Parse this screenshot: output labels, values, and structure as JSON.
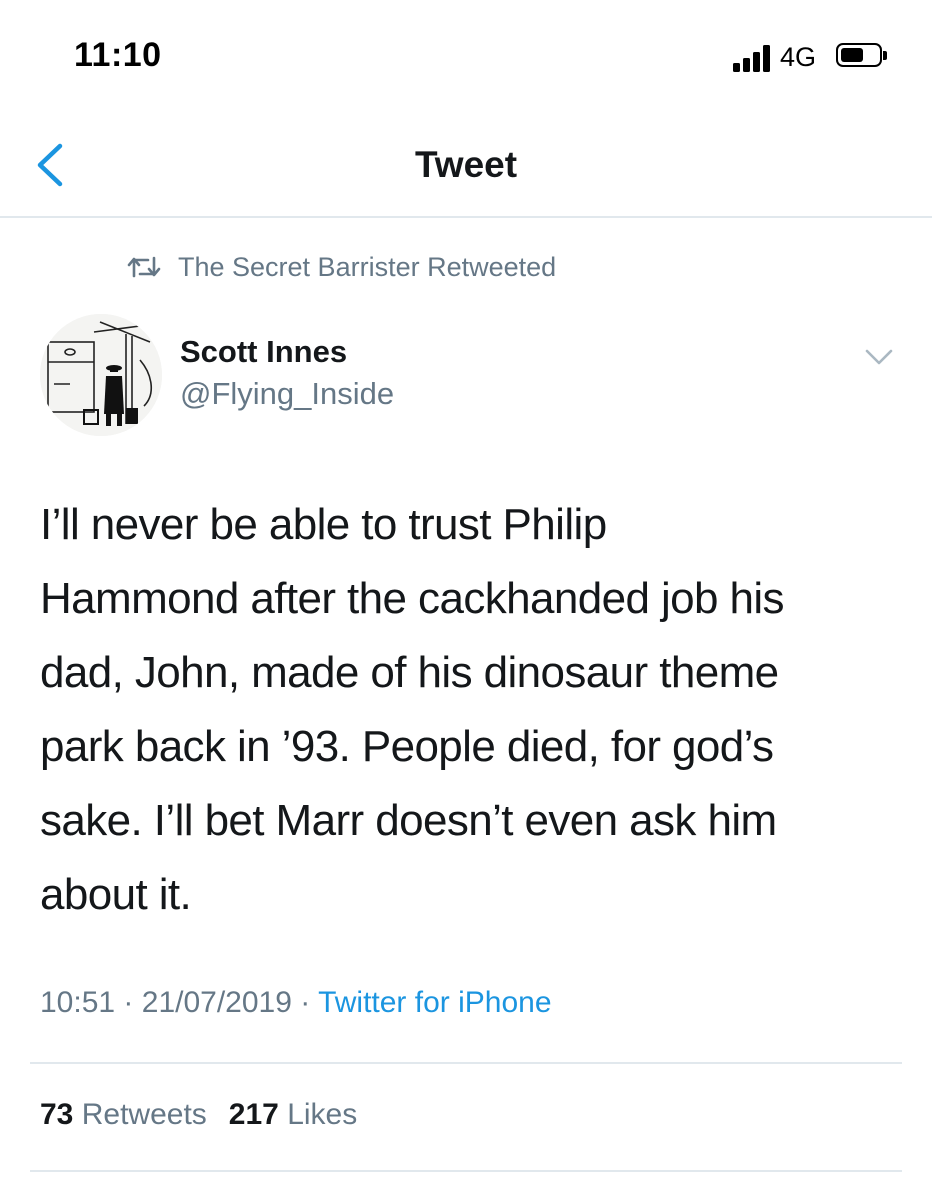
{
  "status_bar": {
    "time": "11:10",
    "network": "4G",
    "battery_level": 0.6
  },
  "nav": {
    "title": "Tweet",
    "back_icon": "chevron-left-icon"
  },
  "retweet_context": {
    "icon": "retweet-icon",
    "text": "The Secret Barrister Retweeted"
  },
  "author": {
    "name": "Scott Innes",
    "handle": "@Flying_Inside"
  },
  "tweet": {
    "lines": [
      "I’ll never be able to trust Philip",
      "Hammond after the cackhanded job his",
      "dad, John, made of his dinosaur theme",
      "park back in ’93. People died, for god’s",
      "sake. I’ll bet Marr doesn’t even ask him",
      "about it."
    ],
    "time": "10:51",
    "separator": "·",
    "date": "21/07/2019",
    "source": "Twitter for iPhone"
  },
  "stats": {
    "retweets_count": "73",
    "retweets_label": "Retweets",
    "likes_count": "217",
    "likes_label": "Likes"
  },
  "colors": {
    "accent": "#1b95e0",
    "secondary_text": "#657786",
    "primary_text": "#14171a",
    "divider": "#e1e8ed"
  }
}
